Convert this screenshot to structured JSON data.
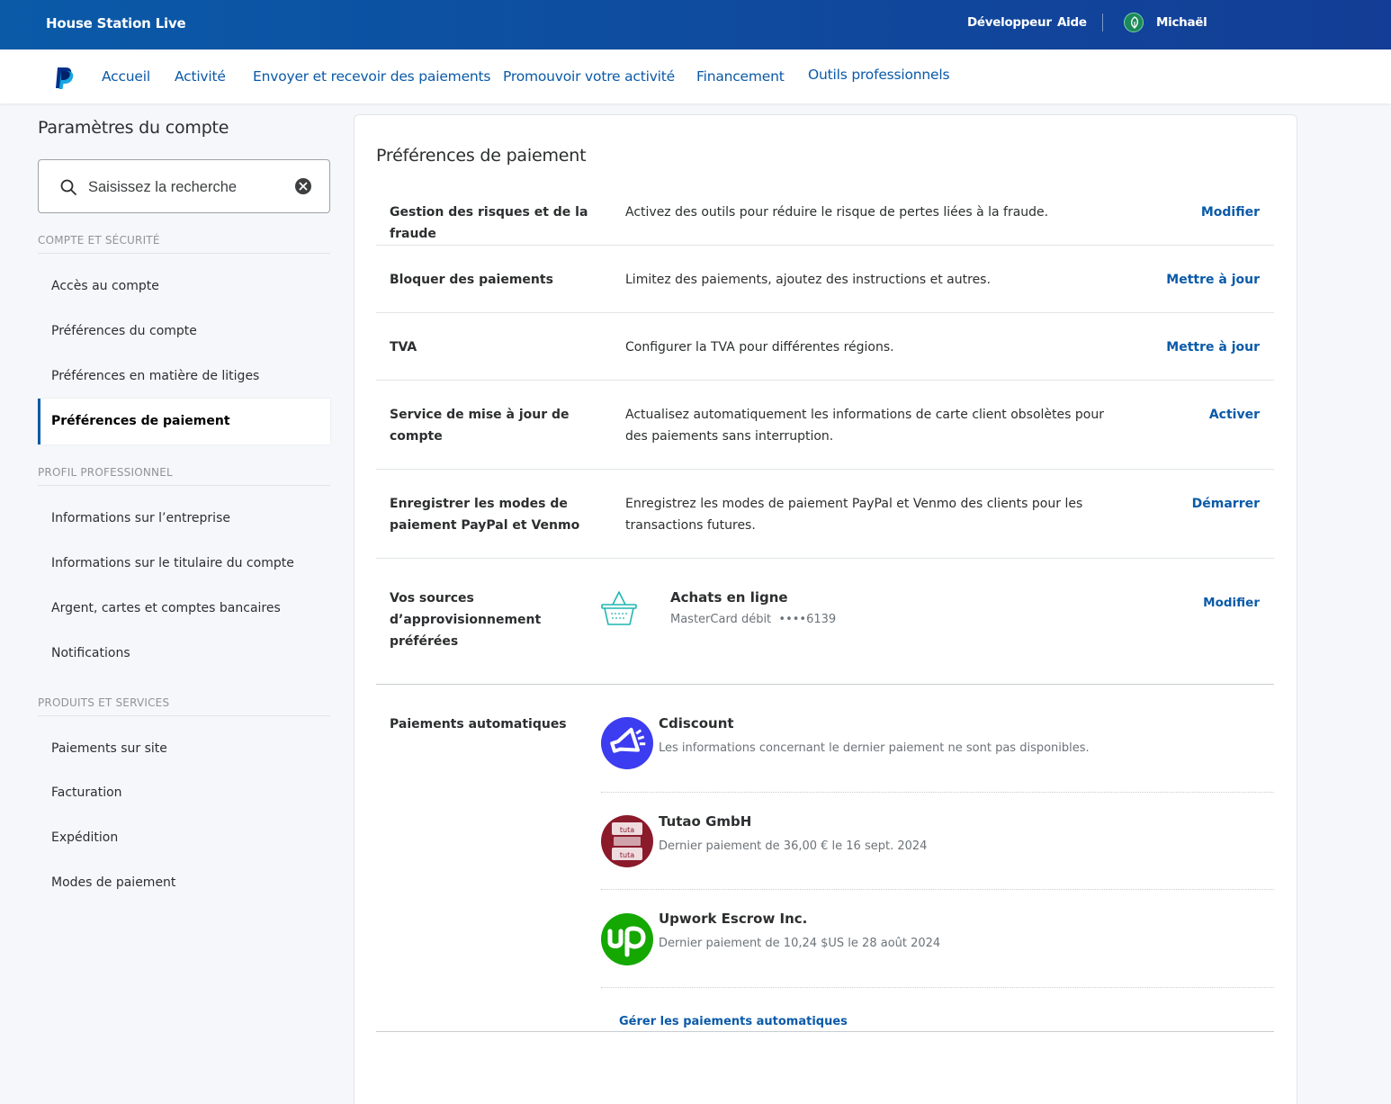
{
  "topbar": {
    "brand": "House Station Live",
    "developer": "Développeur",
    "help": "Aide",
    "user": "Michaël"
  },
  "nav": {
    "items": [
      "Accueil",
      "Activité",
      "Envoyer et recevoir des paiements",
      "Promouvoir votre activité",
      "Financement",
      "Outils professionnels"
    ]
  },
  "sidebar": {
    "title": "Paramètres du compte",
    "search_placeholder": "Saisissez la recherche",
    "sections": [
      {
        "heading": "COMPTE ET SÉCURITÉ",
        "items": [
          "Accès au compte",
          "Préférences du compte",
          "Préférences en matière de litiges",
          "Préférences de paiement"
        ]
      },
      {
        "heading": "PROFIL PROFESSIONNEL",
        "items": [
          "Informations sur l’entreprise",
          "Informations sur le titulaire du compte",
          "Argent, cartes et comptes bancaires",
          "Notifications"
        ]
      },
      {
        "heading": "PRODUITS ET SERVICES",
        "items": [
          "Paiements sur site",
          "Facturation",
          "Expédition",
          "Modes de paiement"
        ]
      }
    ],
    "active_item": "Préférences de paiement"
  },
  "main": {
    "title": "Préférences de paiement",
    "rows": [
      {
        "label": "Gestion des risques et de la fraude",
        "description": "Activez des outils pour réduire le risque de pertes liées à la fraude.",
        "action": "Modifier"
      },
      {
        "label": "Bloquer des paiements",
        "description": "Limitez des paiements, ajoutez des instructions et autres.",
        "action": "Mettre à jour"
      },
      {
        "label": "TVA",
        "description": "Configurer la TVA pour différentes régions.",
        "action": "Mettre à jour"
      },
      {
        "label": "Service de mise à jour de compte",
        "description": "Actualisez automatiquement les informations de carte client obsolètes pour des paiements sans interruption.",
        "action": "Activer"
      },
      {
        "label": "Enregistrer les modes de paiement PayPal et Venmo",
        "description": "Enregistrez les modes de paiement PayPal et Venmo des clients pour les transactions futures.",
        "action": "Démarrer"
      }
    ],
    "funding": {
      "label": "Vos sources d’approvisionnement préférées",
      "name": "Achats en ligne",
      "card": "MasterCard débit",
      "mask": "••••6139",
      "action": "Modifier",
      "icon": "shopping-basket-icon"
    },
    "auto_payments": {
      "label": "Paiements automatiques",
      "merchants": [
        {
          "name": "Cdiscount",
          "detail": "Les informations concernant le dernier paiement ne sont pas disponibles.",
          "color": "#3c3cf0"
        },
        {
          "name": "Tutao GmbH",
          "detail": "Dernier paiement de 36,00 € le 16 sept. 2024",
          "color": "#8b1a2b",
          "logo_text": "tuta"
        },
        {
          "name": "Upwork Escrow Inc.",
          "detail": "Dernier paiement de 10,24 $US le 28 août 2024",
          "color": "#14a800"
        }
      ],
      "manage": "Gérer les paiements automatiques"
    }
  },
  "colors": {
    "brand_blue": "#0a5aa8",
    "link": "#0a5aa8",
    "topbar": "#0f4a9e"
  }
}
